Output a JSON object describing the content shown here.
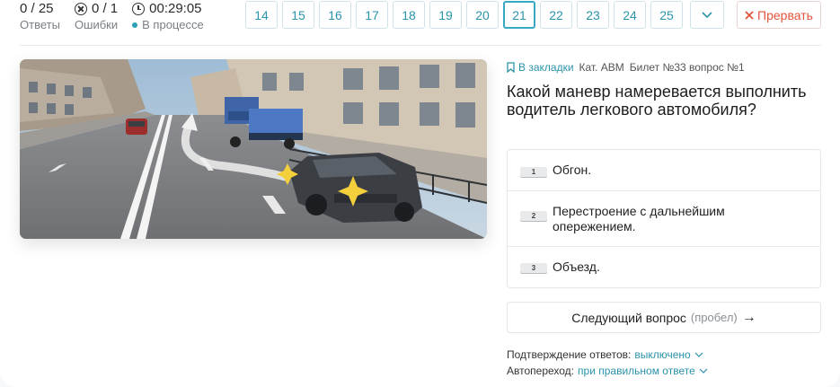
{
  "header": {
    "answers_value": "0 / 25",
    "answers_label": "Ответы",
    "errors_value": "0 / 1",
    "errors_label": "Ошибки",
    "timer_value": "00:29:05",
    "status_label": "В процессе",
    "abort_label": "Прервать"
  },
  "nav": {
    "questions": [
      "14",
      "15",
      "16",
      "17",
      "18",
      "19",
      "20",
      "21",
      "22",
      "23",
      "24",
      "25"
    ],
    "active": "21"
  },
  "meta": {
    "bookmark_label": "В закладки",
    "category": "Кат. ABM",
    "ticket": "Билет №33 вопрос №1"
  },
  "question": "Какой маневр намеревается выполнить водитель легкового автомобиля?",
  "answers": [
    {
      "key": "1",
      "text": "Обгон."
    },
    {
      "key": "2",
      "text": "Перестроение с дальнейшим опережением."
    },
    {
      "key": "3",
      "text": "Объезд."
    }
  ],
  "next": {
    "label": "Следующий вопрос",
    "hint": "(пробел)",
    "arrow": "→"
  },
  "settings": {
    "confirm_label": "Подтверждение ответов:",
    "confirm_value": "выключено",
    "auto_label": "Автопереход:",
    "auto_value": "при правильном ответе"
  },
  "colors": {
    "accent": "#2b93ab",
    "danger": "#e4533d",
    "status_dot": "#2ba0b8"
  }
}
